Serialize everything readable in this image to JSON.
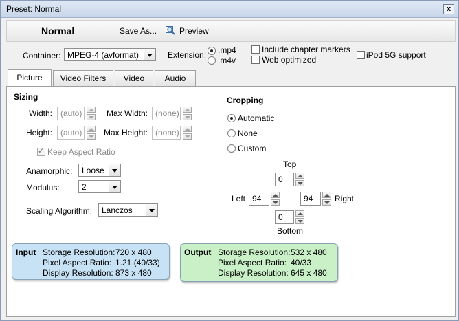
{
  "window": {
    "title": "Preset: Normal",
    "close": "x"
  },
  "toolbar": {
    "preset_name": "Normal",
    "save_as": "Save As...",
    "preview": "Preview"
  },
  "container": {
    "label": "Container:",
    "value": "MPEG-4 (avformat)"
  },
  "extension": {
    "label": "Extension:",
    "options": [
      ".mp4",
      ".m4v"
    ],
    "selected": ".mp4"
  },
  "options": {
    "chapter_markers": "Include chapter markers",
    "web_optimized": "Web optimized",
    "ipod": "iPod 5G support"
  },
  "tabs": [
    "Picture",
    "Video Filters",
    "Video",
    "Audio"
  ],
  "active_tab": "Picture",
  "sizing": {
    "title": "Sizing",
    "width_label": "Width:",
    "width_value": "(auto)",
    "max_width_label": "Max Width:",
    "max_width_value": "(none)",
    "height_label": "Height:",
    "height_value": "(auto)",
    "max_height_label": "Max Height:",
    "max_height_value": "(none)",
    "keep_aspect": "Keep Aspect Ratio",
    "anamorphic_label": "Anamorphic:",
    "anamorphic_value": "Loose",
    "modulus_label": "Modulus:",
    "modulus_value": "2",
    "scaling_label": "Scaling Algorithm:",
    "scaling_value": "Lanczos"
  },
  "cropping": {
    "title": "Cropping",
    "automatic": "Automatic",
    "none": "None",
    "custom": "Custom",
    "selected": "Automatic",
    "top_label": "Top",
    "top_value": "0",
    "left_label": "Left",
    "left_value": "94",
    "right_label": "Right",
    "right_value": "94",
    "bottom_label": "Bottom",
    "bottom_value": "0"
  },
  "input": {
    "title": "Input",
    "storage_label": "Storage Resolution:",
    "storage_value": "720 x 480",
    "par_label": "Pixel Aspect Ratio:",
    "par_value": "1.21 (40/33)",
    "display_label": "Display Resolution:",
    "display_value": "873 x 480"
  },
  "output": {
    "title": "Output",
    "storage_label": "Storage Resolution:",
    "storage_value": "532 x 480",
    "par_label": "Pixel Aspect Ratio:",
    "par_value": "40/33",
    "display_label": "Display Resolution:",
    "display_value": "645 x 480"
  },
  "colors": {
    "input_bg": "#c7e1f5",
    "output_bg": "#c9f0c6",
    "title_bar": "#d3dfef"
  }
}
